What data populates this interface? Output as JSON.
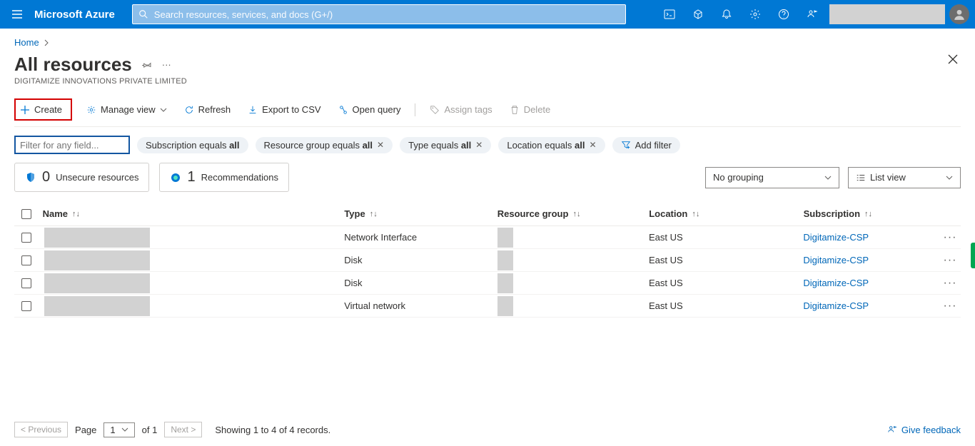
{
  "header": {
    "brand": "Microsoft Azure",
    "search_placeholder": "Search resources, services, and docs (G+/)"
  },
  "breadcrumb": {
    "home": "Home"
  },
  "page": {
    "title": "All resources",
    "subtitle": "DIGITAMIZE INNOVATIONS PRIVATE LIMITED"
  },
  "toolbar": {
    "create": "Create",
    "manage_view": "Manage view",
    "refresh": "Refresh",
    "export_csv": "Export to CSV",
    "open_query": "Open query",
    "assign_tags": "Assign tags",
    "delete": "Delete"
  },
  "filters": {
    "input_placeholder": "Filter for any field...",
    "subscription_pre": "Subscription equals ",
    "subscription_val": "all",
    "rg_pre": "Resource group equals ",
    "rg_val": "all",
    "type_pre": "Type equals ",
    "type_val": "all",
    "location_pre": "Location equals ",
    "location_val": "all",
    "add_filter": "Add filter"
  },
  "stats": {
    "unsecure_count": "0",
    "unsecure_label": "Unsecure resources",
    "rec_count": "1",
    "rec_label": "Recommendations"
  },
  "controls": {
    "grouping": "No grouping",
    "view": "List view"
  },
  "columns": {
    "name": "Name",
    "type": "Type",
    "rg": "Resource group",
    "location": "Location",
    "subscription": "Subscription"
  },
  "rows": [
    {
      "type": "Network Interface",
      "location": "East US",
      "subscription": "Digitamize-CSP"
    },
    {
      "type": "Disk",
      "location": "East US",
      "subscription": "Digitamize-CSP"
    },
    {
      "type": "Disk",
      "location": "East US",
      "subscription": "Digitamize-CSP"
    },
    {
      "type": "Virtual network",
      "location": "East US",
      "subscription": "Digitamize-CSP"
    }
  ],
  "paging": {
    "previous": "< Previous",
    "page_label": "Page",
    "page_num": "1",
    "of": "of 1",
    "next": "Next >",
    "showing": "Showing 1 to 4 of 4 records."
  },
  "feedback": {
    "label": "Give feedback"
  }
}
